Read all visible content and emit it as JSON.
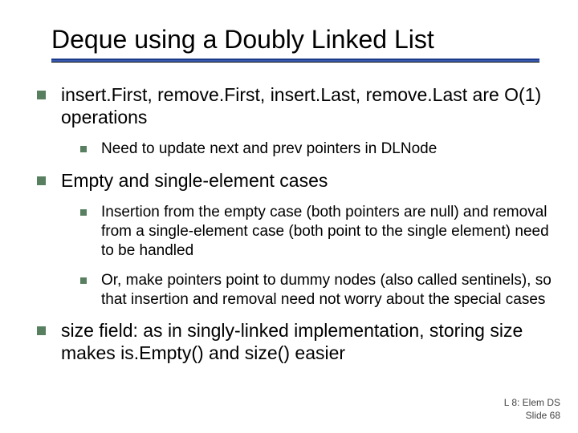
{
  "title": "Deque using a Doubly Linked List",
  "bullets": [
    {
      "text": "insert.First, remove.First, insert.Last, remove.Last are O(1) operations",
      "children": [
        {
          "text": "Need to update next and prev pointers in DLNode"
        }
      ]
    },
    {
      "text": "Empty and single-element cases",
      "children": [
        {
          "text": "Insertion from the empty case (both pointers are null) and removal from a single-element case (both point to the single element) need to be handled"
        },
        {
          "text": "Or, make pointers point to dummy nodes (also called sentinels), so that insertion and removal need not worry about the special cases"
        }
      ]
    },
    {
      "text": "size field: as in singly-linked implementation, storing size makes is.Empty() and size() easier",
      "children": []
    }
  ],
  "footer": {
    "line1": "L 8: Elem DS",
    "line2": "Slide 68"
  }
}
